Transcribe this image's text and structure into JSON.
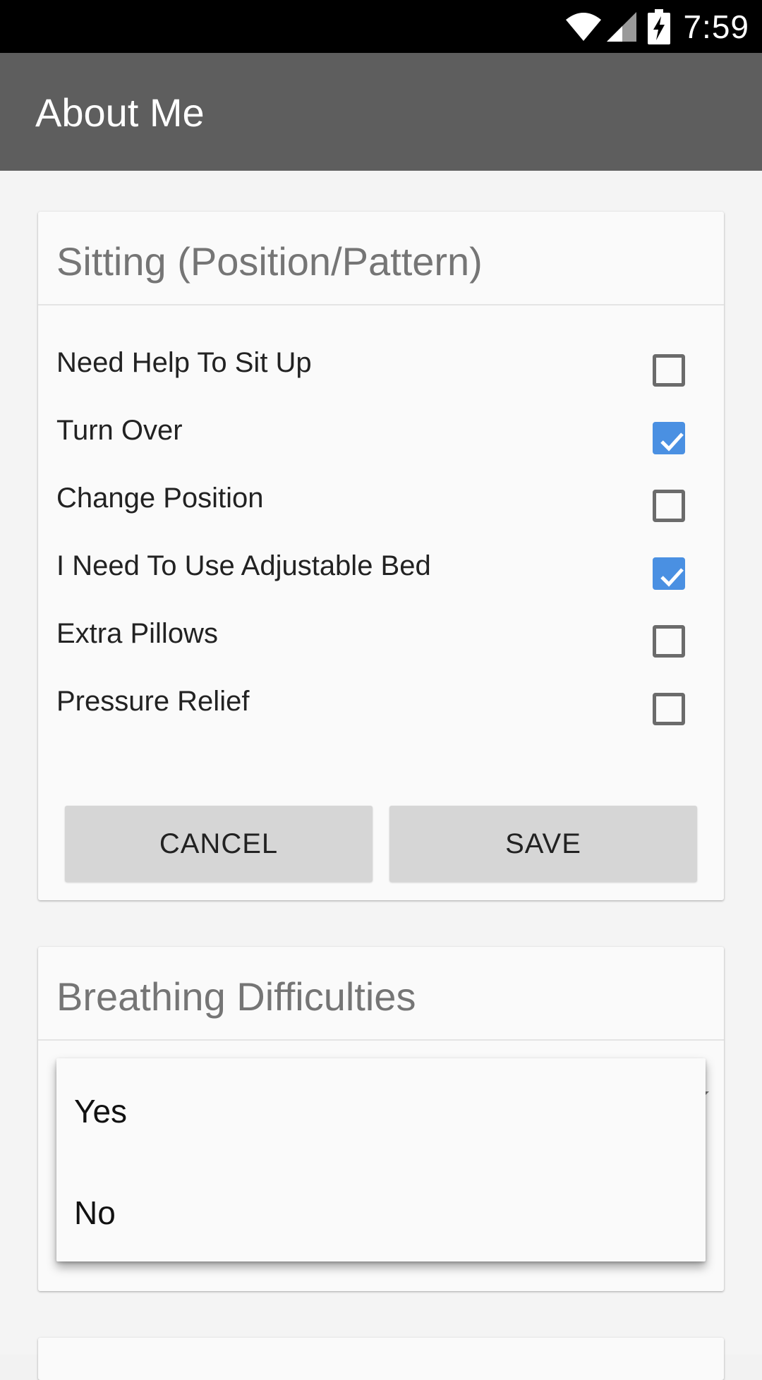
{
  "status_bar": {
    "time": "7:59",
    "icons": [
      "wifi-icon",
      "cell-signal-icon",
      "battery-charging-icon"
    ]
  },
  "app_bar": {
    "title": "About Me"
  },
  "sitting_card": {
    "title": "Sitting (Position/Pattern)",
    "options": [
      {
        "label": "Need Help To Sit Up",
        "checked": false
      },
      {
        "label": "Turn Over",
        "checked": true
      },
      {
        "label": "Change Position",
        "checked": false
      },
      {
        "label": "I Need To Use Adjustable Bed",
        "checked": true
      },
      {
        "label": "Extra Pillows",
        "checked": false
      },
      {
        "label": "Pressure Relief",
        "checked": false
      }
    ],
    "cancel_label": "CANCEL",
    "save_label": "SAVE"
  },
  "breathing_card": {
    "title": "Breathing Difficulties",
    "dropdown_options": [
      "Yes",
      "No"
    ]
  },
  "colors": {
    "status_bar": "#000000",
    "app_bar": "#5e5e5e",
    "checkbox_checked": "#4a90e2",
    "button_bg": "#d6d6d6"
  }
}
